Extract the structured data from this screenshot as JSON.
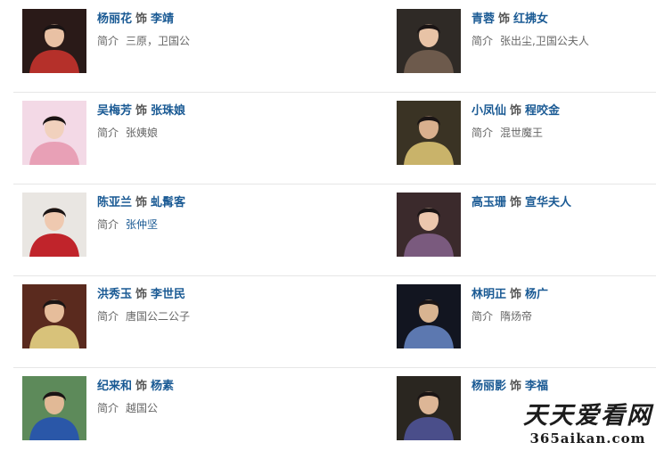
{
  "cast": [
    {
      "actor": "杨丽花",
      "shi": "饰",
      "role": "李靖",
      "intro_label": "简介",
      "intro": "三原，卫国公",
      "intro_link": false,
      "photo": {
        "icon": "actor-photo",
        "bg": "#2a1a18",
        "accent": "#b5302a",
        "face": "#e9c1a4"
      }
    },
    {
      "actor": "青蓉",
      "shi": "饰",
      "role": "红拂女",
      "intro_label": "简介",
      "intro": "张出尘,卫国公夫人",
      "intro_link": false,
      "photo": {
        "icon": "actor-photo",
        "bg": "#2f2a26",
        "accent": "#6d5a4c",
        "face": "#e8c3a6"
      }
    },
    {
      "actor": "吴梅芳",
      "shi": "饰",
      "role": "张珠娘",
      "intro_label": "简介",
      "intro": "张姨娘",
      "intro_link": false,
      "photo": {
        "icon": "actor-photo",
        "bg": "#f3d9e6",
        "accent": "#e8a0b6",
        "face": "#f1d1bd"
      }
    },
    {
      "actor": "小凤仙",
      "shi": "饰",
      "role": "程咬金",
      "intro_label": "简介",
      "intro": "混世魔王",
      "intro_link": false,
      "photo": {
        "icon": "actor-photo",
        "bg": "#3a3324",
        "accent": "#c9b36a",
        "face": "#d9b08e"
      }
    },
    {
      "actor": "陈亚兰",
      "shi": "饰",
      "role": "虬髯客",
      "intro_label": "简介",
      "intro": "张仲坚",
      "intro_link": true,
      "photo": {
        "icon": "actor-photo",
        "bg": "#e9e6e2",
        "accent": "#c0242b",
        "face": "#efc9b0"
      }
    },
    {
      "actor": "高玉珊",
      "shi": "饰",
      "role": "宣华夫人",
      "intro_label": "",
      "intro": "",
      "intro_link": false,
      "photo": {
        "icon": "actor-photo",
        "bg": "#3b2a2c",
        "accent": "#7a5a7e",
        "face": "#ecc7ad"
      }
    },
    {
      "actor": "洪秀玉",
      "shi": "饰",
      "role": "李世民",
      "intro_label": "简介",
      "intro": "唐国公二公子",
      "intro_link": false,
      "photo": {
        "icon": "actor-photo",
        "bg": "#5a2a1e",
        "accent": "#d8c27a",
        "face": "#e6bd9b"
      }
    },
    {
      "actor": "林明正",
      "shi": "饰",
      "role": "杨广",
      "intro_label": "简介",
      "intro": "隋炀帝",
      "intro_link": false,
      "photo": {
        "icon": "actor-photo",
        "bg": "#121520",
        "accent": "#5c78b0",
        "face": "#d8b491"
      }
    },
    {
      "actor": "纪来和",
      "shi": "饰",
      "role": "杨素",
      "intro_label": "简介",
      "intro": "越国公",
      "intro_link": false,
      "photo": {
        "icon": "actor-photo",
        "bg": "#5d8a5a",
        "accent": "#2a57a8",
        "face": "#e1b996"
      }
    },
    {
      "actor": "杨丽影",
      "shi": "饰",
      "role": "李福",
      "intro_label": "",
      "intro": "",
      "intro_link": false,
      "photo": {
        "icon": "actor-photo",
        "bg": "#2a2620",
        "accent": "#4a4e8a",
        "face": "#ddb696"
      }
    }
  ],
  "watermark": {
    "line1": "天天爱看网",
    "line2": "365aikan.com"
  }
}
